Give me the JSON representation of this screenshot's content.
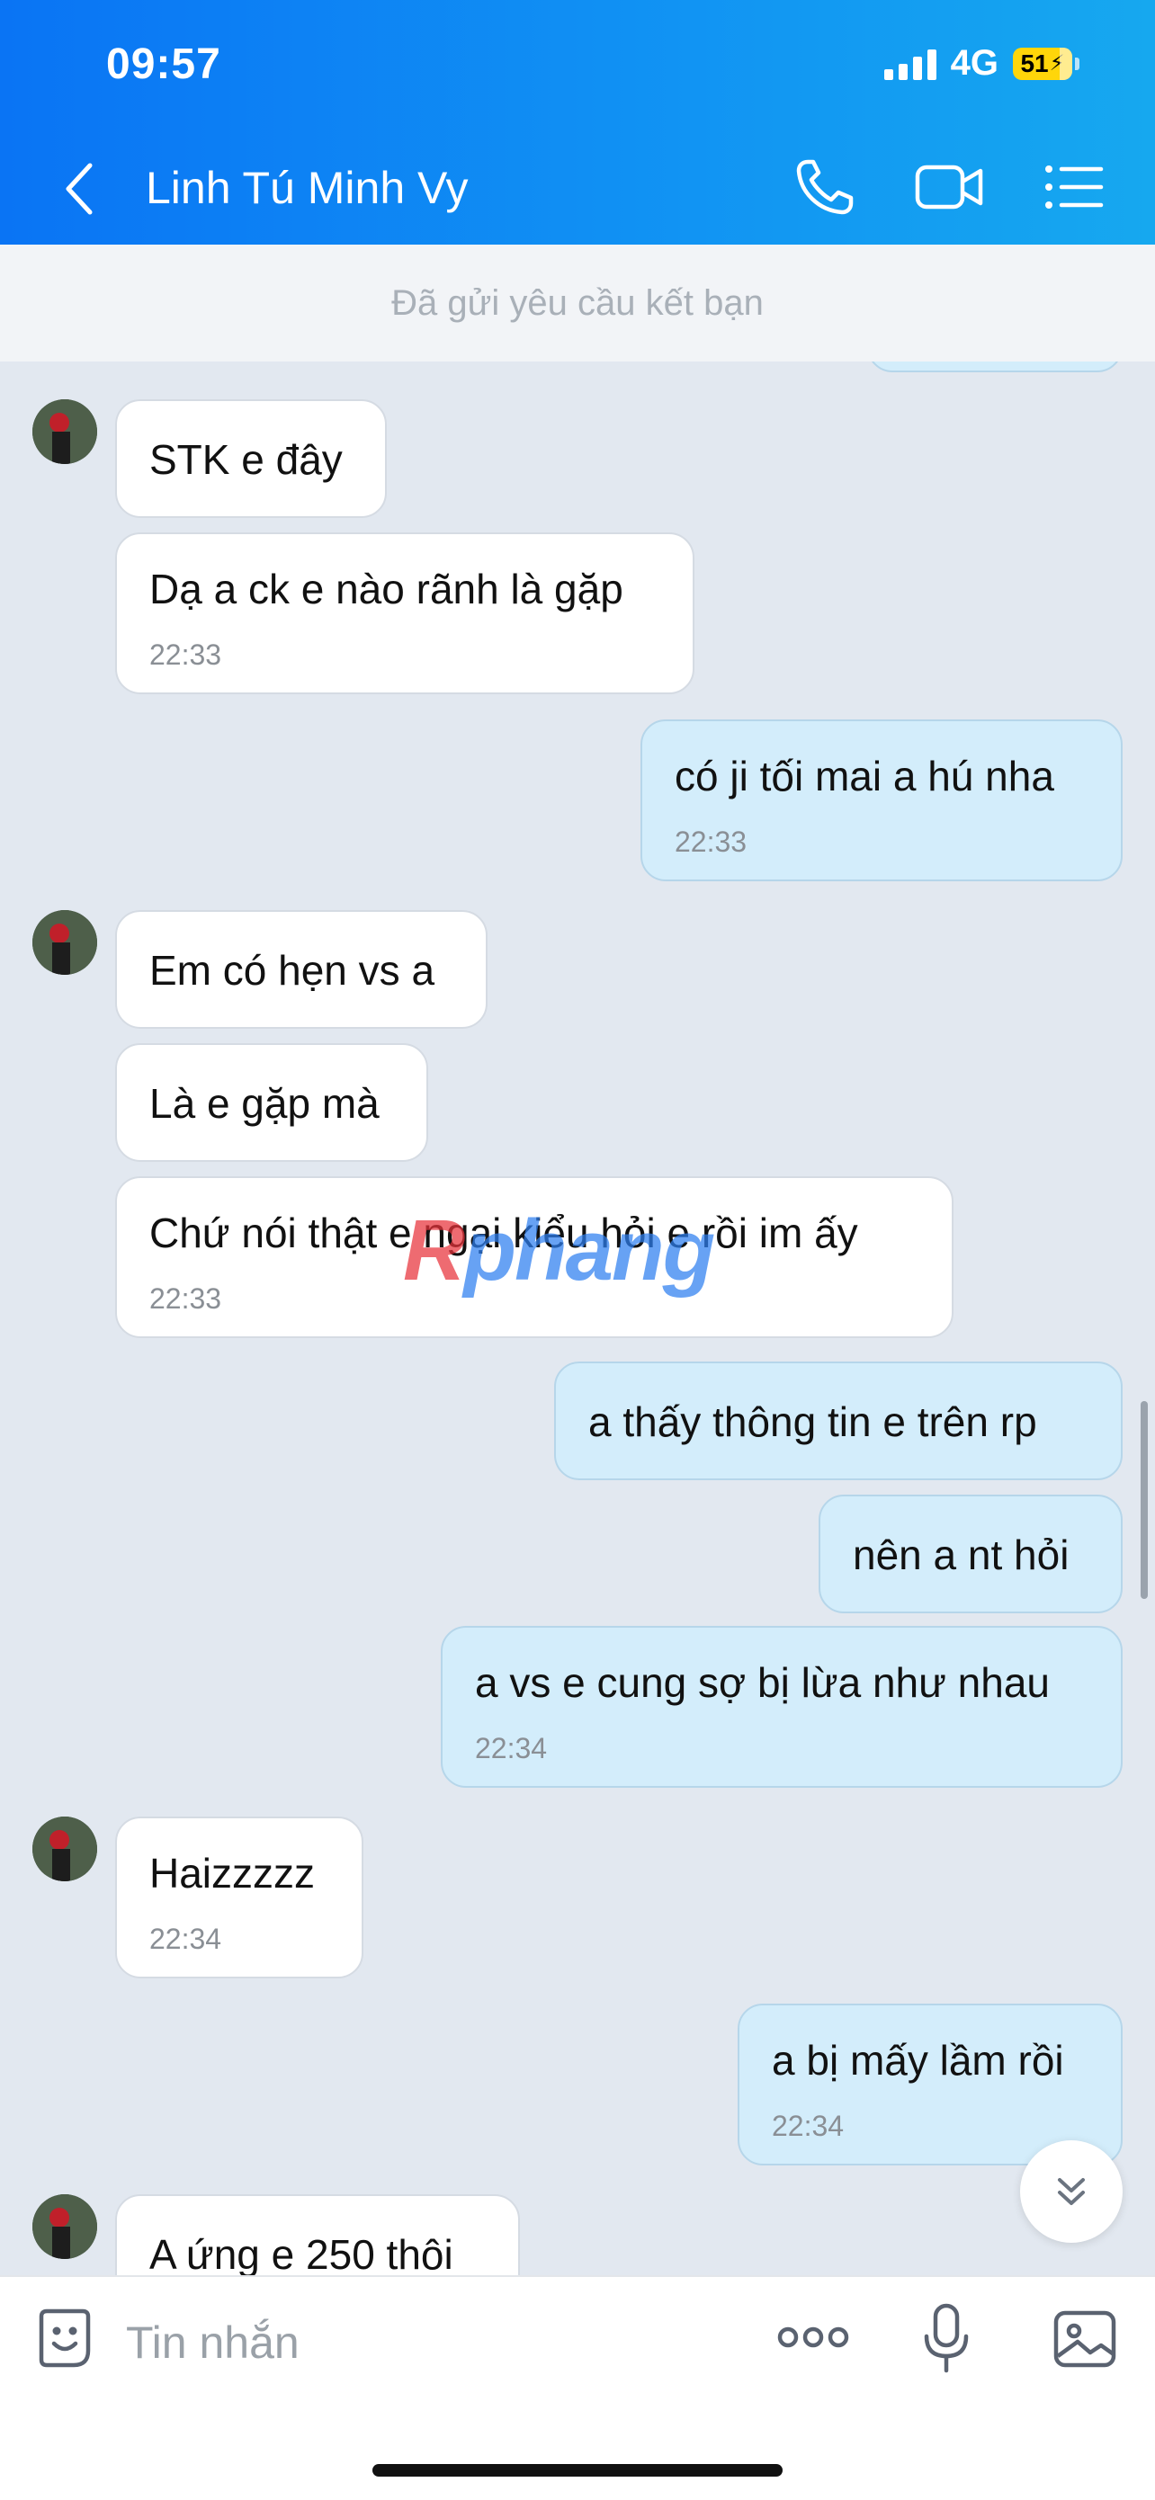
{
  "status_bar": {
    "time": "09:57",
    "network": "4G",
    "battery": "51"
  },
  "header": {
    "contact_name": "Linh Tú Minh Vy"
  },
  "banner": {
    "text": "Đã gửi yêu cầu kết bạn"
  },
  "messages": [
    {
      "dir": "in",
      "text": "STK e đây"
    },
    {
      "dir": "in",
      "text": "Dạ a ck e nào rãnh là gặp",
      "time": "22:33"
    },
    {
      "dir": "out",
      "text": "có ji tối mai a hú nha",
      "time": "22:33"
    },
    {
      "dir": "in",
      "text": "Em có hẹn vs a"
    },
    {
      "dir": "in",
      "text": "Là e gặp mà"
    },
    {
      "dir": "in",
      "text": "Chứ nói thật e ngại kiểu hỏi e rồi im ấy",
      "time": "22:33"
    },
    {
      "dir": "out",
      "text": "a thấy thông tin e trên rp"
    },
    {
      "dir": "out",
      "text": "nên a nt hỏi"
    },
    {
      "dir": "out",
      "text": "a vs e cung sợ bị lừa như nhau",
      "time": "22:34"
    },
    {
      "dir": "in",
      "text": "Haizzzzz",
      "time": "22:34"
    },
    {
      "dir": "out",
      "text": "a bị mấy lầm rồi",
      "time": "22:34"
    },
    {
      "dir": "in",
      "text": "A ứng e 250 thôi"
    }
  ],
  "watermark": {
    "part1": "R",
    "part2": "phang"
  },
  "input": {
    "placeholder": "Tin nhắn"
  },
  "icons": {
    "back": "chevron-left-icon",
    "call": "phone-icon",
    "video": "video-camera-icon",
    "menu": "list-menu-icon",
    "emoji": "emoji-sticker-icon",
    "more": "more-dots-icon",
    "mic": "microphone-icon",
    "image": "image-icon",
    "scroll": "chevron-double-down-icon"
  }
}
